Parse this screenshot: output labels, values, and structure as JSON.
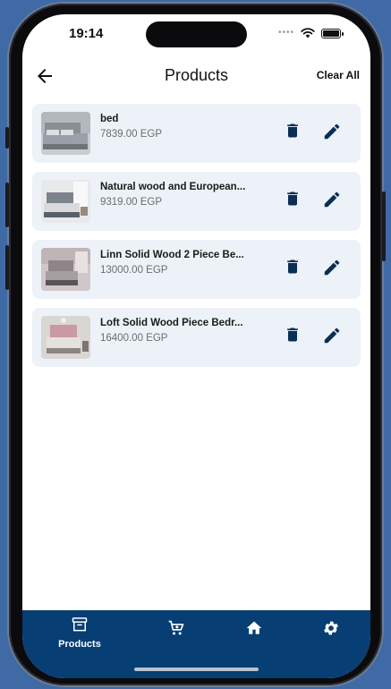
{
  "status_bar": {
    "time": "19:14",
    "signal": "••••"
  },
  "app_bar": {
    "title": "Products",
    "clear_all_label": "Clear All",
    "back_icon": "arrow-left-icon"
  },
  "products": [
    {
      "name": "bed",
      "price": "7839.00 EGP"
    },
    {
      "name": "Natural wood and European...",
      "price": "9319.00 EGP"
    },
    {
      "name": "Linn Solid Wood 2 Piece Be...",
      "price": "13000.00 EGP"
    },
    {
      "name": "Loft Solid Wood Piece Bedr...",
      "price": "16400.00 EGP"
    }
  ],
  "bottom_nav": {
    "items": [
      {
        "icon": "archive-box-icon",
        "label": "Products",
        "active": true
      },
      {
        "icon": "cart-icon",
        "label": ""
      },
      {
        "icon": "home-icon",
        "label": ""
      },
      {
        "icon": "gear-icon",
        "label": ""
      }
    ]
  },
  "colors": {
    "background": "#3f6aa6",
    "card": "#edf2f8",
    "nav": "#073e74",
    "icon_dark": "#0b2e52"
  }
}
